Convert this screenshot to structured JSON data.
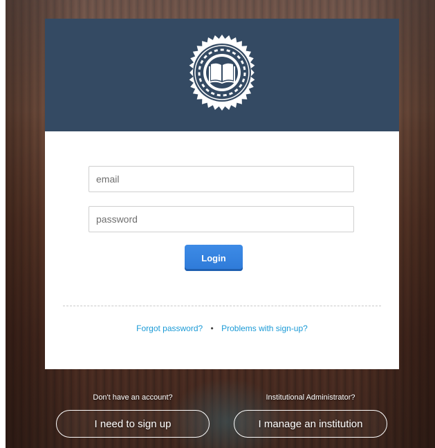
{
  "login_form": {
    "email_placeholder": "email",
    "password_placeholder": "password",
    "login_label": "Login"
  },
  "links": {
    "forgot_password": "Forgot password?",
    "separator": "•",
    "problems_signup": "Problems with sign-up?"
  },
  "signup": {
    "prompt": "Don't have an account?",
    "button_label": "I need to sign up"
  },
  "institution": {
    "prompt": "Institutional Administrator?",
    "button_label": "I manage an institution"
  },
  "colors": {
    "header_background": "#344a63",
    "primary_button": "#2e7ad8",
    "link": "#1a9ad6"
  },
  "icons": {
    "logo": "book-seal-icon"
  }
}
